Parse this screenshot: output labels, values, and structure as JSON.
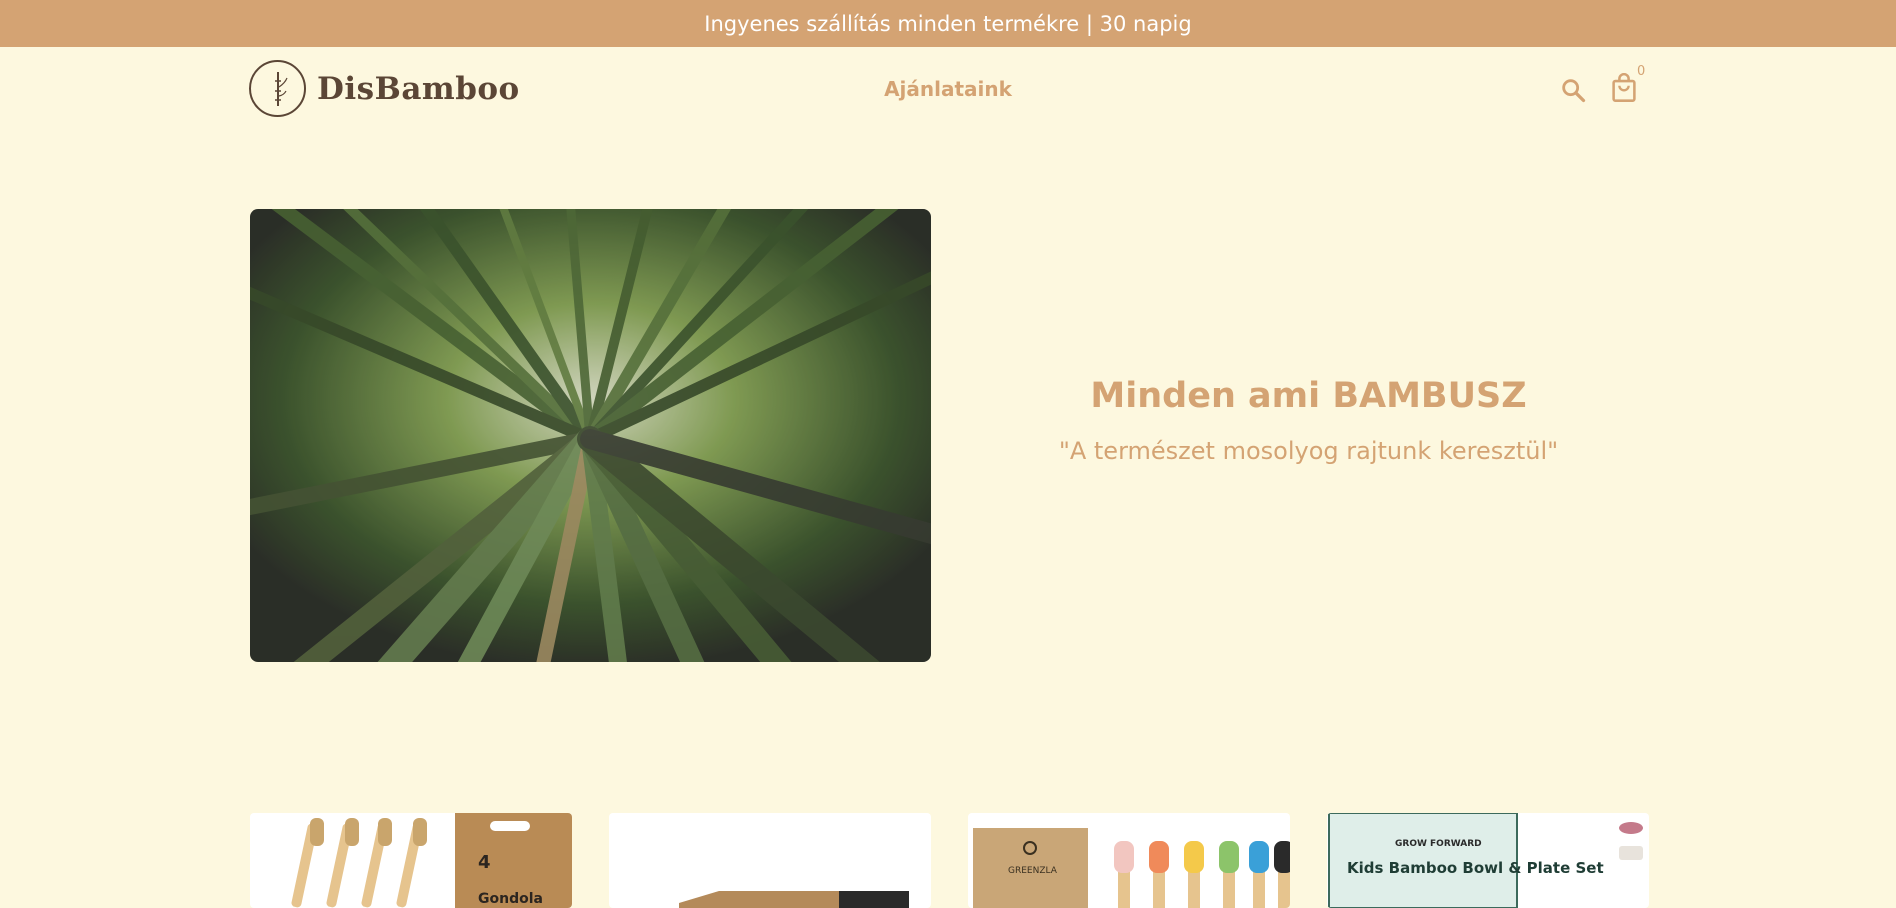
{
  "announcement": {
    "text": "Ingyenes szállítás minden termékre | 30 napig"
  },
  "header": {
    "logo_text": "DisBamboo",
    "nav": [
      {
        "label": "Ajánlataink"
      }
    ],
    "cart_count": "0",
    "icons": {
      "search": "search-icon",
      "cart": "shopping-bag-icon"
    }
  },
  "hero": {
    "title": "Minden ami BAMBUSZ",
    "subtitle": "\"A természet mosolyog rajtunk keresztül\"",
    "image": "bamboo-forest-photo"
  },
  "products": [
    {
      "image": "bamboo-toothbrush-gondola-4pack",
      "box_text": "Gondola",
      "pack_number": "4"
    },
    {
      "image": "bamboo-box-product"
    },
    {
      "image": "greenzla-kids-toothbrush-set",
      "box_text": "GREENZLA"
    },
    {
      "image": "kids-bamboo-bowl-plate-set",
      "brand_text": "GROW FORWARD",
      "box_text": "Kids Bamboo Bowl & Plate Set"
    }
  ],
  "colors": {
    "background": "#fdf8df",
    "accent": "#d4a373",
    "logo": "#5b4636",
    "card": "#ffffff"
  }
}
